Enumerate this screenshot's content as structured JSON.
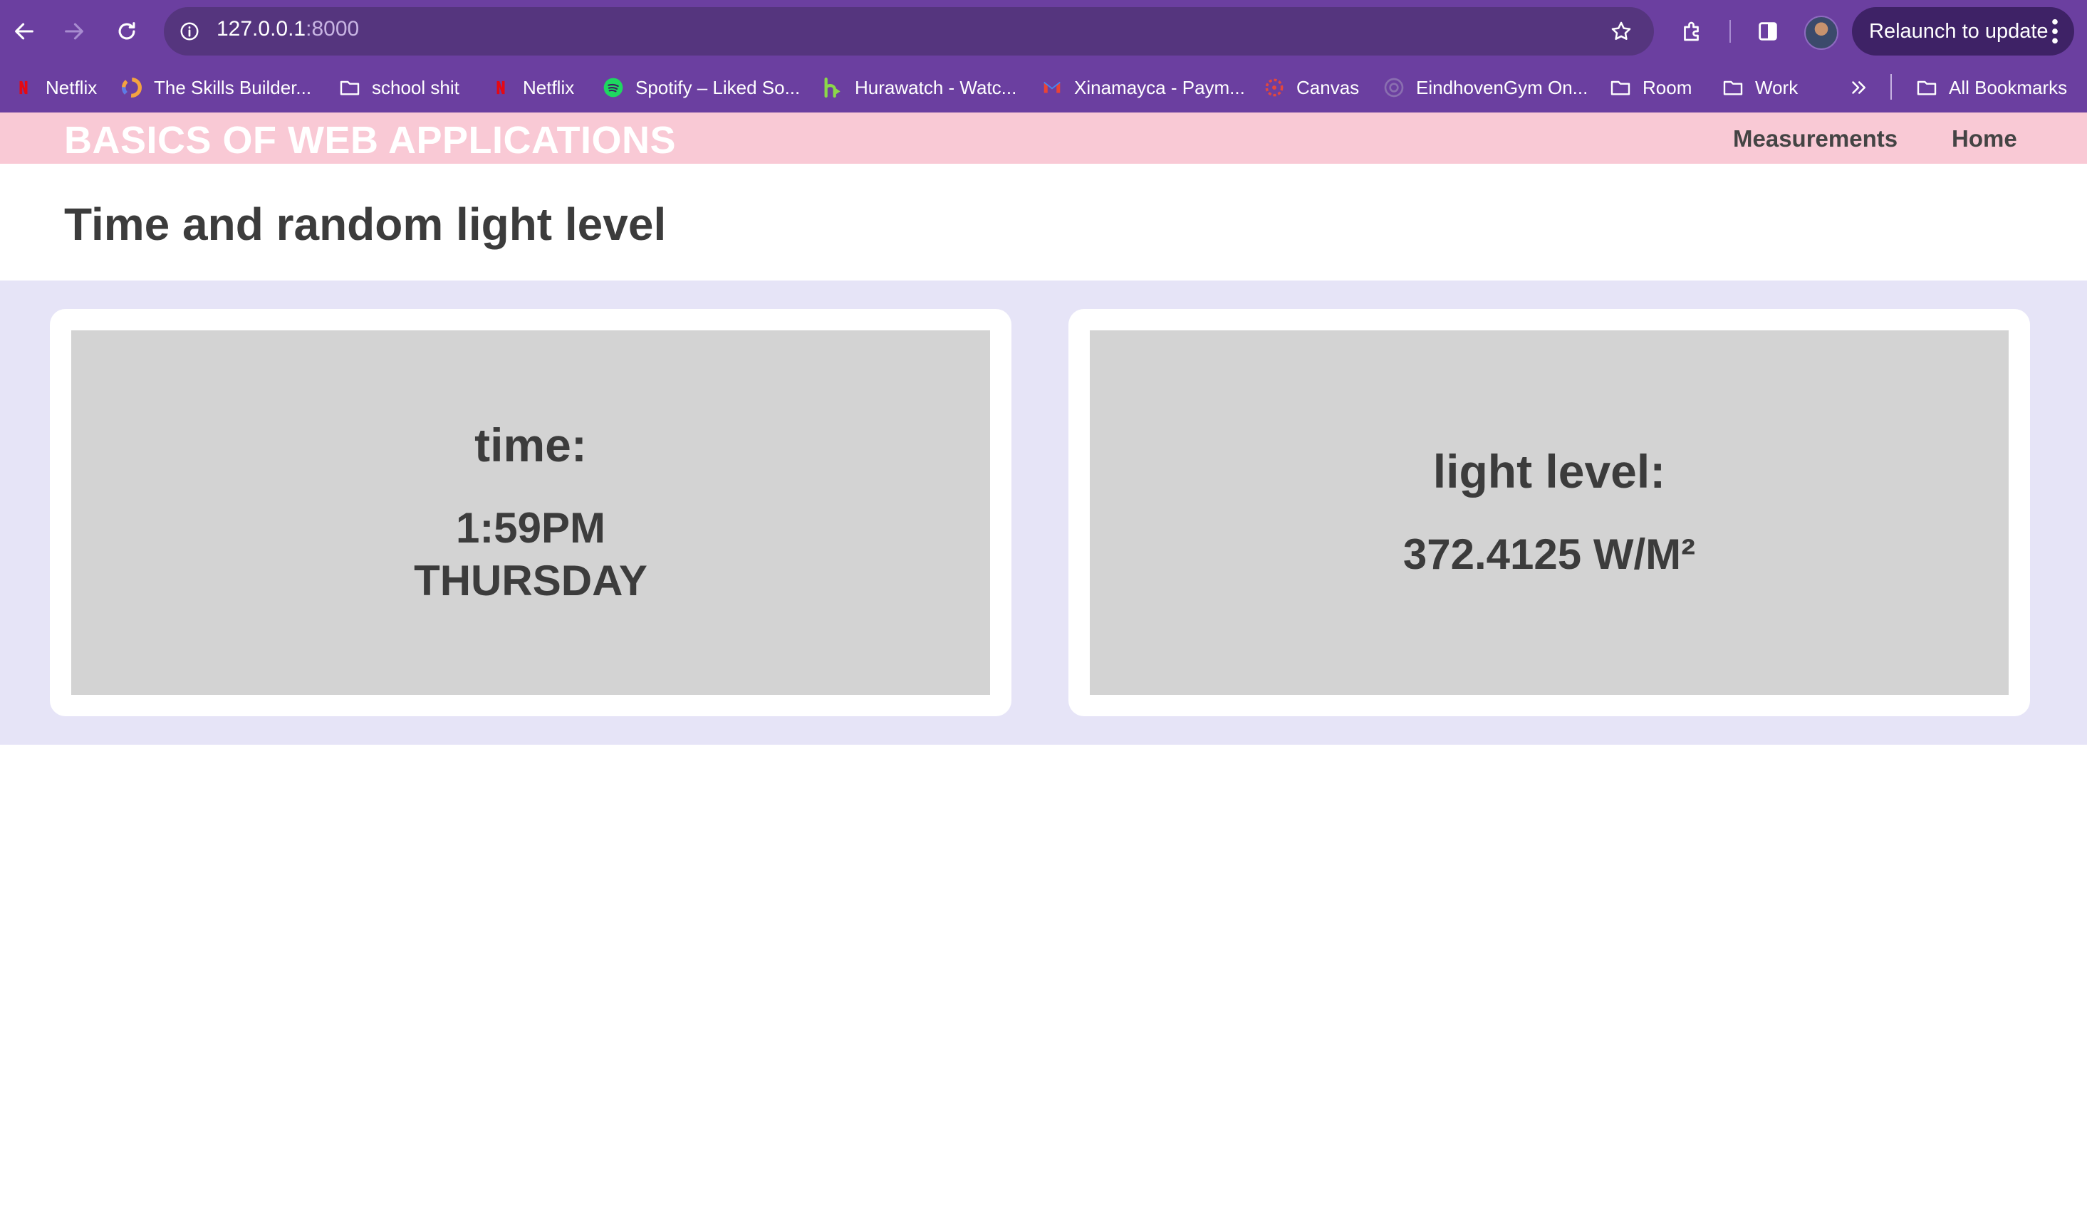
{
  "browser": {
    "url_host": "127.0.0.1",
    "url_port": ":8000",
    "relaunch_label": "Relaunch to update",
    "theme_color": "#6b3fa0"
  },
  "bookmarks": [
    {
      "label": "Netflix",
      "icon": "netflix-icon"
    },
    {
      "label": "The Skills Builder...",
      "icon": "skills-builder-icon"
    },
    {
      "label": "school shit",
      "icon": "folder-icon"
    },
    {
      "label": "Netflix",
      "icon": "netflix-icon"
    },
    {
      "label": "Spotify – Liked So...",
      "icon": "spotify-icon"
    },
    {
      "label": "Hurawatch - Watc...",
      "icon": "hurawatch-icon"
    },
    {
      "label": "Xinamayca - Paym...",
      "icon": "gmail-icon"
    },
    {
      "label": "Canvas",
      "icon": "canvas-icon"
    },
    {
      "label": "EindhovenGym On...",
      "icon": "globe-icon"
    },
    {
      "label": "Room",
      "icon": "folder-icon"
    },
    {
      "label": "Work",
      "icon": "folder-icon"
    }
  ],
  "bookmarks_all_label": "All Bookmarks",
  "site": {
    "title": "BASICS OF WEB APPLICATIONS",
    "nav": [
      "Measurements",
      "Home"
    ],
    "header_color": "#f9c9d5"
  },
  "main": {
    "heading": "Time and random light level",
    "area_color": "#e6e4f7",
    "cards": [
      {
        "label": "time:",
        "value_lines": [
          "1:59PM",
          "THURSDAY"
        ]
      },
      {
        "label": "light level:",
        "value_lines": [
          "372.4125 W/M²"
        ]
      }
    ]
  }
}
